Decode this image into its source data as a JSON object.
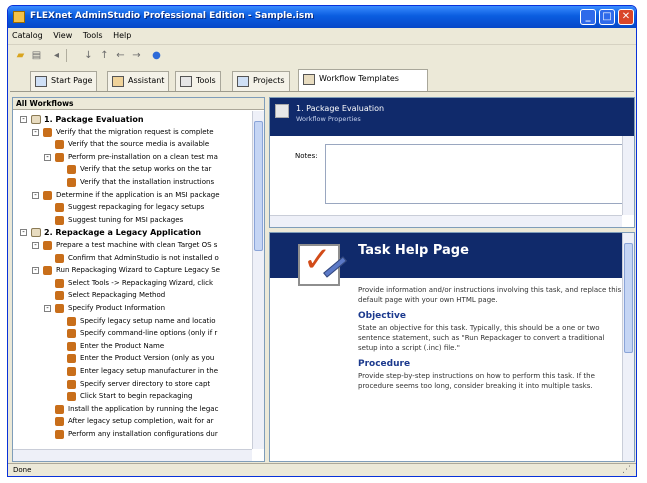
{
  "window": {
    "title": "FLEXnet AdminStudio Professional Edition - Sample.ism",
    "controls": {
      "minimize": "_",
      "maximize": "□",
      "close": "✕"
    }
  },
  "menu": [
    "Catalog",
    "View",
    "Tools",
    "Help"
  ],
  "toolbar": {
    "icons": [
      "open-folder-icon",
      "properties-icon",
      "back-icon",
      "separator",
      "move-down-icon",
      "move-up-icon",
      "arrow-left-icon",
      "arrow-right-icon",
      "help-globe-icon"
    ]
  },
  "tabs": [
    {
      "label": "Start Page",
      "active": false
    },
    {
      "label": "Assistant",
      "active": false
    },
    {
      "label": "Tools",
      "active": false
    },
    {
      "label": "Projects",
      "active": false
    },
    {
      "label": "Workflow Templates",
      "active": true
    }
  ],
  "left_pane": {
    "header": "All Workflows",
    "tree": [
      {
        "level": 0,
        "expander": "-",
        "type": "phase",
        "text": "1. Package Evaluation"
      },
      {
        "level": 1,
        "expander": "-",
        "type": "task",
        "text": "Verify that the migration request is complete"
      },
      {
        "level": 2,
        "expander": "",
        "type": "task",
        "text": "Verify that the source media is available"
      },
      {
        "level": 2,
        "expander": "-",
        "type": "task",
        "text": "Perform pre-installation on a clean test ma"
      },
      {
        "level": 3,
        "expander": "",
        "type": "task",
        "text": "Verify that the setup works on the tar"
      },
      {
        "level": 3,
        "expander": "",
        "type": "task",
        "text": "Verify that the installation instructions"
      },
      {
        "level": 1,
        "expander": "-",
        "type": "task",
        "text": "Determine if the application is an MSI package"
      },
      {
        "level": 2,
        "expander": "",
        "type": "task",
        "text": "Suggest repackaging for legacy setups"
      },
      {
        "level": 2,
        "expander": "",
        "type": "task",
        "text": "Suggest tuning for MSI packages"
      },
      {
        "level": 0,
        "expander": "-",
        "type": "phase",
        "text": "2. Repackage a Legacy Application"
      },
      {
        "level": 1,
        "expander": "-",
        "type": "task",
        "text": "Prepare a test machine with clean Target OS s"
      },
      {
        "level": 2,
        "expander": "",
        "type": "task",
        "text": "Confirm that AdminStudio is not installed o"
      },
      {
        "level": 1,
        "expander": "-",
        "type": "task",
        "text": "Run Repackaging Wizard to Capture Legacy Se"
      },
      {
        "level": 2,
        "expander": "",
        "type": "task",
        "text": "Select Tools -> Repackaging Wizard, click"
      },
      {
        "level": 2,
        "expander": "",
        "type": "task",
        "text": "Select Repackaging Method"
      },
      {
        "level": 2,
        "expander": "-",
        "type": "task",
        "text": "Specify Product Information"
      },
      {
        "level": 3,
        "expander": "",
        "type": "task",
        "text": "Specify legacy setup name and locatio"
      },
      {
        "level": 3,
        "expander": "",
        "type": "task",
        "text": "Specify command-line options (only if r"
      },
      {
        "level": 3,
        "expander": "",
        "type": "task",
        "text": "Enter the Product Name"
      },
      {
        "level": 3,
        "expander": "",
        "type": "task",
        "text": "Enter the Product Version (only as you"
      },
      {
        "level": 3,
        "expander": "",
        "type": "task",
        "text": "Enter legacy setup manufacturer in the"
      },
      {
        "level": 3,
        "expander": "",
        "type": "task",
        "text": "Specify server directory to store capt"
      },
      {
        "level": 3,
        "expander": "",
        "type": "task",
        "text": "Click Start to begin repackaging"
      },
      {
        "level": 2,
        "expander": "",
        "type": "task",
        "text": "Install the application by running the legac"
      },
      {
        "level": 2,
        "expander": "",
        "type": "task",
        "text": "After legacy setup completion, wait for ar"
      },
      {
        "level": 2,
        "expander": "",
        "type": "task",
        "text": "Perform any installation configurations dur"
      }
    ]
  },
  "right_top": {
    "title": "1. Package Evaluation",
    "subtitle": "Workflow Properties",
    "notes_label": "Notes:"
  },
  "right_bottom": {
    "title": "Task Help Page",
    "intro": "Provide information and/or instructions involving this task, and replace this default page with your own HTML page.",
    "objective_heading": "Objective",
    "objective_text": "State an objective for this task. Typically, this should be a one or two sentence statement, such as \"Run Repackager to convert a traditional setup into a script (.inc) file.\"",
    "procedure_heading": "Procedure",
    "procedure_text": "Provide step-by-step instructions on how to perform this task. If the procedure seems too long, consider breaking it into multiple tasks."
  },
  "status": {
    "text": "Done"
  },
  "colors": {
    "titlebar": "#0A5DE0",
    "pane_header": "#102A6B",
    "accent_task_icon": "#C86E1A",
    "heading_blue": "#1C3A8E"
  }
}
